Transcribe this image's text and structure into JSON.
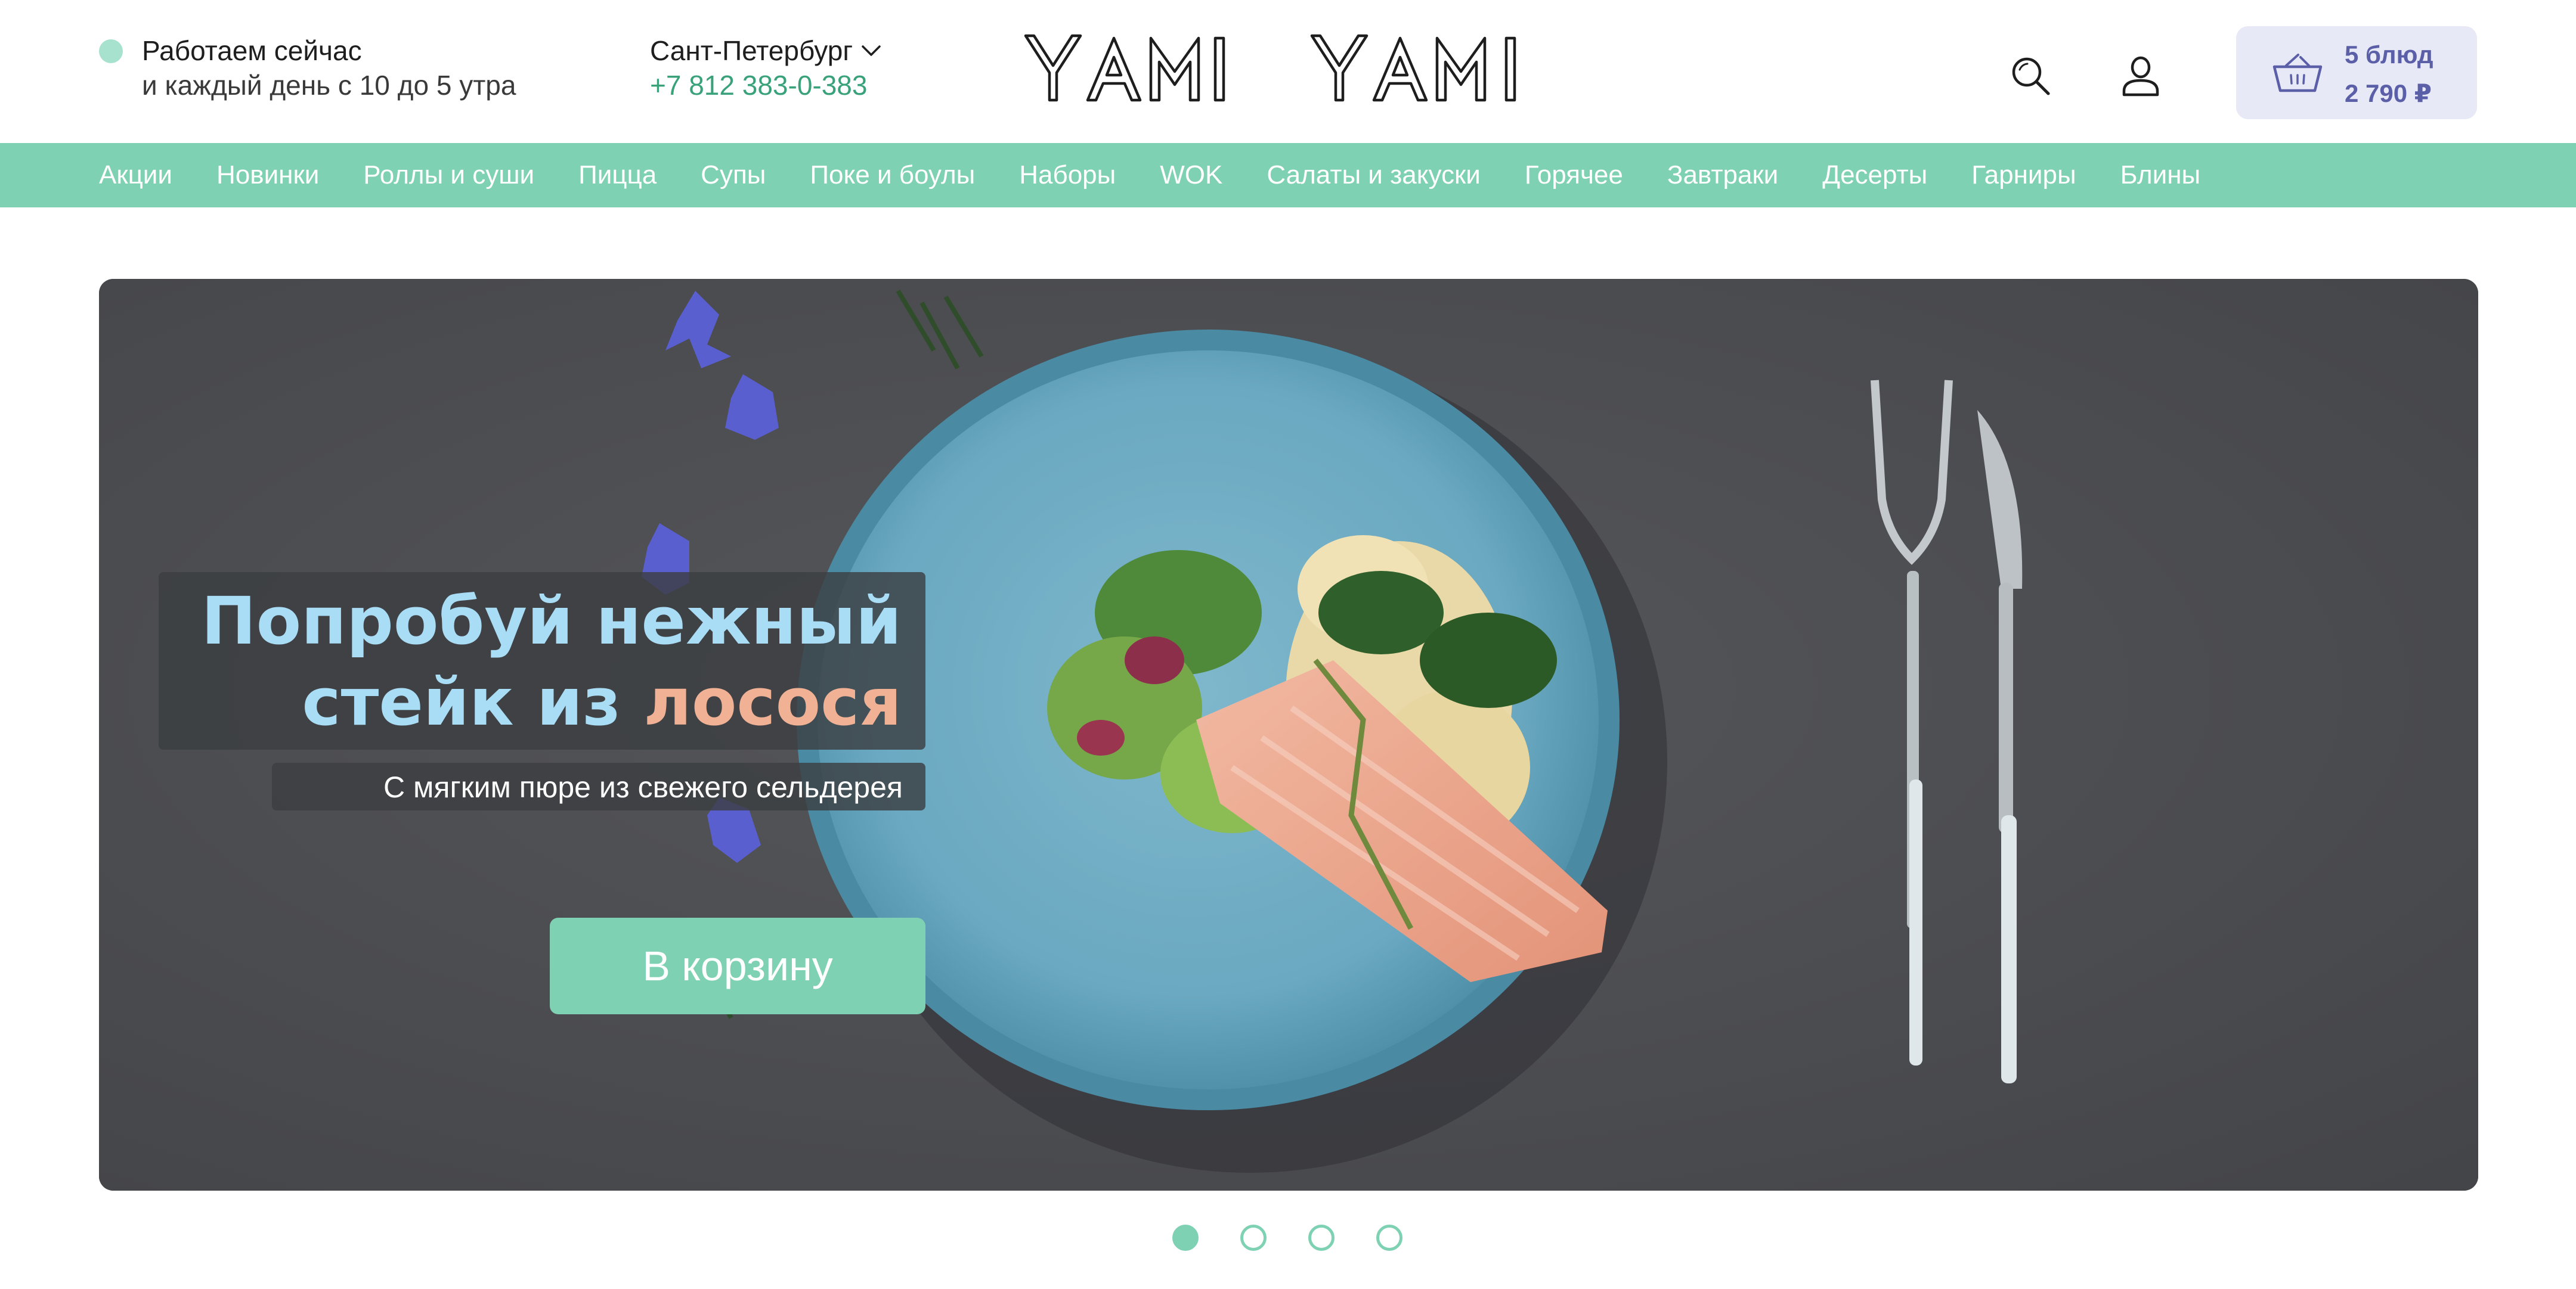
{
  "header": {
    "status": {
      "title": "Работаем сейчас",
      "hours": "и каждый день с 10 до 5 утра",
      "indicator_color": "#a6e2cd"
    },
    "city": "Сант-Петербург",
    "phone": "+7 812 383-0-383",
    "logo_text": "YAMI YAMI",
    "icons": {
      "search": "search-icon",
      "user": "user-icon",
      "cart": "basket-icon"
    },
    "cart": {
      "count": "5 блюд",
      "total": "2 790 ₽"
    }
  },
  "nav": {
    "items": [
      "Акции",
      "Новинки",
      "Роллы и суши",
      "Пицца",
      "Супы",
      "Поке и боулы",
      "Наборы",
      "WOK",
      "Салаты и закуски",
      "Горячее",
      "Завтраки",
      "Десерты",
      "Гарниры",
      "Блины"
    ]
  },
  "hero": {
    "title_line1": "Попробуй нежный",
    "title_line2_start": "стейк из ",
    "title_line2_accent": "лосося",
    "subtitle": "С мягким пюре из свежего сельдерея",
    "cta": "В корзину"
  },
  "slider": {
    "total": 4,
    "active": 1
  },
  "colors": {
    "accent": "#7ed1b3",
    "phone": "#3aa27a",
    "cart_bg": "#e8e9f6",
    "cart_text": "#5a5fa8",
    "hero_title": "#a9dcf5",
    "hero_accent": "#f0b195"
  }
}
